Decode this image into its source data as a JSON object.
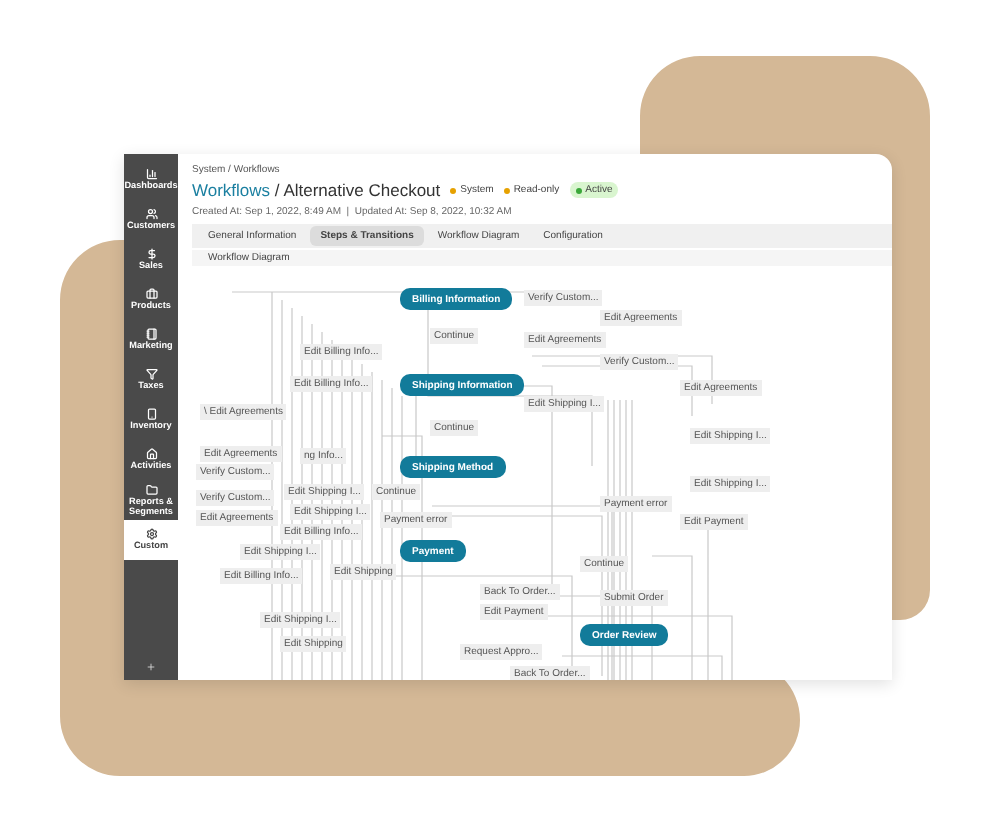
{
  "sidebar": {
    "items": [
      {
        "label": "Dashboards",
        "selected": false
      },
      {
        "label": "Customers",
        "selected": false
      },
      {
        "label": "Sales",
        "selected": false
      },
      {
        "label": "Products",
        "selected": false
      },
      {
        "label": "Marketing",
        "selected": false
      },
      {
        "label": "Taxes",
        "selected": false
      },
      {
        "label": "Inventory",
        "selected": false
      },
      {
        "label": "Activities",
        "selected": false
      },
      {
        "label": "Reports & Segments",
        "selected": false
      },
      {
        "label": "Custom",
        "selected": true
      }
    ]
  },
  "breadcrumb": "System / Workflows",
  "title": {
    "link": "Workflows",
    "separator": "/",
    "page": "Alternative Checkout"
  },
  "badges": [
    {
      "label": "System",
      "kind": "dot",
      "color": "#e6a100"
    },
    {
      "label": "Read-only",
      "kind": "dot",
      "color": "#e6a100"
    },
    {
      "label": "Active",
      "kind": "pill",
      "color": "#3aa83a"
    }
  ],
  "meta": "Created At: Sep 1, 2022, 8:49 AM  |  Updated At: Sep 8, 2022, 10:32 AM",
  "tabs": [
    {
      "label": "General Information",
      "selected": false
    },
    {
      "label": "Steps & Transitions",
      "selected": true
    },
    {
      "label": "Workflow Diagram",
      "selected": false
    },
    {
      "label": "Configuration",
      "selected": false
    }
  ],
  "subtab": "Workflow Diagram",
  "diagram": {
    "steps": [
      {
        "label": "Billing Information"
      },
      {
        "label": "Shipping Information"
      },
      {
        "label": "Shipping Method"
      },
      {
        "label": "Payment"
      },
      {
        "label": "Order Review"
      }
    ],
    "transitions": [
      {
        "label": "Verify Custom..."
      },
      {
        "label": "Edit Agreements"
      },
      {
        "label": "Continue"
      },
      {
        "label": "Edit Agreements"
      },
      {
        "label": "Edit Billing Info..."
      },
      {
        "label": "Verify Custom..."
      },
      {
        "label": "Edit Billing Info..."
      },
      {
        "label": "Edit Shipping I..."
      },
      {
        "label": "Edit Agreements"
      },
      {
        "label": "\\ Edit Agreements"
      },
      {
        "label": "Continue"
      },
      {
        "label": "Edit Shipping I..."
      },
      {
        "label": "Edit Agreements"
      },
      {
        "label": "ng Info..."
      },
      {
        "label": "Verify Custom..."
      },
      {
        "label": "Verify Custom..."
      },
      {
        "label": "Edit Agreements"
      },
      {
        "label": "Edit Shipping I..."
      },
      {
        "label": "Continue"
      },
      {
        "label": "Edit Shipping I..."
      },
      {
        "label": "Payment error"
      },
      {
        "label": "Edit Payment"
      },
      {
        "label": "Edit Shipping I..."
      },
      {
        "label": "Payment error"
      },
      {
        "label": "Edit Billing Info..."
      },
      {
        "label": "Edit Shipping I..."
      },
      {
        "label": "Edit Shipping"
      },
      {
        "label": "Edit Billing Info..."
      },
      {
        "label": "Continue"
      },
      {
        "label": "Back To Order..."
      },
      {
        "label": "Submit Order"
      },
      {
        "label": "Edit Payment"
      },
      {
        "label": "Edit Shipping I..."
      },
      {
        "label": "Edit Shipping"
      },
      {
        "label": "Request Appro..."
      },
      {
        "label": "Back To Order..."
      }
    ]
  }
}
